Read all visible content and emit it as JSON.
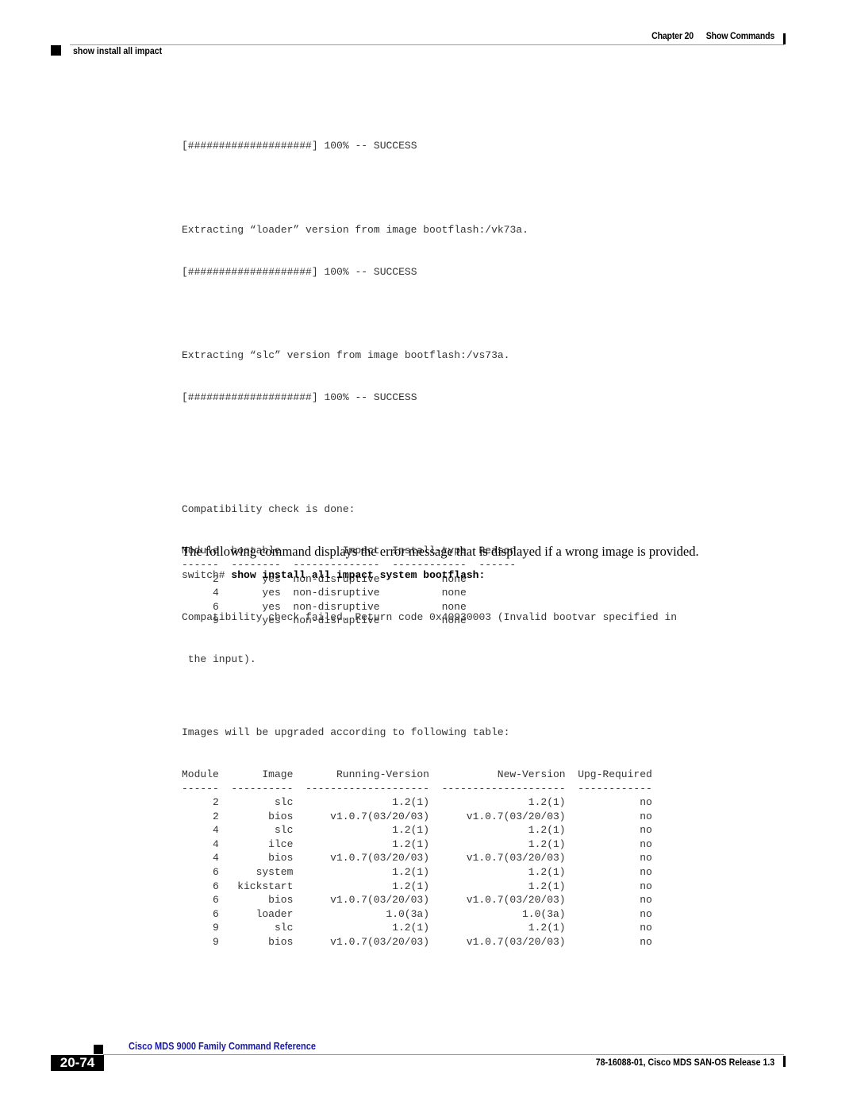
{
  "header": {
    "chapter": "Chapter 20",
    "chapter_title": "Show Commands",
    "section": "show install all impact"
  },
  "progress": [
    {
      "bar": "[####################]",
      "percent": "100%",
      "status": "-- SUCCESS"
    }
  ],
  "extract_loader": {
    "text": "Extracting “loader” version from image bootflash:/vk73a.",
    "bar": "[####################]",
    "percent": "100%",
    "status": "-- SUCCESS"
  },
  "extract_slc": {
    "text": "Extracting “slc” version from image bootflash:/vs73a.",
    "bar": "[####################]",
    "percent": "100%",
    "status": "-- SUCCESS"
  },
  "compat": {
    "title": "Compatibility check is done:",
    "headers": [
      "Module",
      "bootable",
      "Impact",
      "Install-type",
      "Reason"
    ],
    "dashes": [
      "------",
      "--------",
      "--------------",
      "------------",
      "------"
    ],
    "rows": [
      {
        "module": "2",
        "bootable": "yes",
        "impact": "non-disruptive",
        "install_type": "none",
        "reason": ""
      },
      {
        "module": "4",
        "bootable": "yes",
        "impact": "non-disruptive",
        "install_type": "none",
        "reason": ""
      },
      {
        "module": "6",
        "bootable": "yes",
        "impact": "non-disruptive",
        "install_type": "none",
        "reason": ""
      },
      {
        "module": "9",
        "bootable": "yes",
        "impact": "non-disruptive",
        "install_type": "none",
        "reason": ""
      }
    ]
  },
  "upgrade": {
    "title": "Images will be upgraded according to following table:",
    "headers": [
      "Module",
      "Image",
      "Running-Version",
      "New-Version",
      "Upg-Required"
    ],
    "dashes": [
      "------",
      "----------",
      "--------------------",
      "--------------------",
      "------------"
    ],
    "rows": [
      {
        "module": "2",
        "image": "slc",
        "running": "1.2(1)",
        "new": "1.2(1)",
        "upg": "no"
      },
      {
        "module": "2",
        "image": "bios",
        "running": "v1.0.7(03/20/03)",
        "new": "v1.0.7(03/20/03)",
        "upg": "no"
      },
      {
        "module": "4",
        "image": "slc",
        "running": "1.2(1)",
        "new": "1.2(1)",
        "upg": "no"
      },
      {
        "module": "4",
        "image": "ilce",
        "running": "1.2(1)",
        "new": "1.2(1)",
        "upg": "no"
      },
      {
        "module": "4",
        "image": "bios",
        "running": "v1.0.7(03/20/03)",
        "new": "v1.0.7(03/20/03)",
        "upg": "no"
      },
      {
        "module": "6",
        "image": "system",
        "running": "1.2(1)",
        "new": "1.2(1)",
        "upg": "no"
      },
      {
        "module": "6",
        "image": "kickstart",
        "running": "1.2(1)",
        "new": "1.2(1)",
        "upg": "no"
      },
      {
        "module": "6",
        "image": "bios",
        "running": "v1.0.7(03/20/03)",
        "new": "v1.0.7(03/20/03)",
        "upg": "no"
      },
      {
        "module": "6",
        "image": "loader",
        "running": "1.0(3a)",
        "new": "1.0(3a)",
        "upg": "no"
      },
      {
        "module": "9",
        "image": "slc",
        "running": "1.2(1)",
        "new": "1.2(1)",
        "upg": "no"
      },
      {
        "module": "9",
        "image": "bios",
        "running": "v1.0.7(03/20/03)",
        "new": "v1.0.7(03/20/03)",
        "upg": "no"
      }
    ]
  },
  "body_paragraph": "The following command displays the error message that is displayed if a wrong image is provided.",
  "command": {
    "prompt": "switch# ",
    "text": "show install all impact system bootflash:"
  },
  "error_output": [
    "Compatibility check failed. Return code 0x40930003 (Invalid bootvar specified in",
    " the input)."
  ],
  "footer": {
    "book_title": "Cisco MDS 9000 Family Command Reference",
    "page_number": "20-74",
    "release": "78-16088-01, Cisco MDS SAN-OS Release 1.3"
  },
  "colors": {
    "footer_title": "#1a1aa6"
  }
}
